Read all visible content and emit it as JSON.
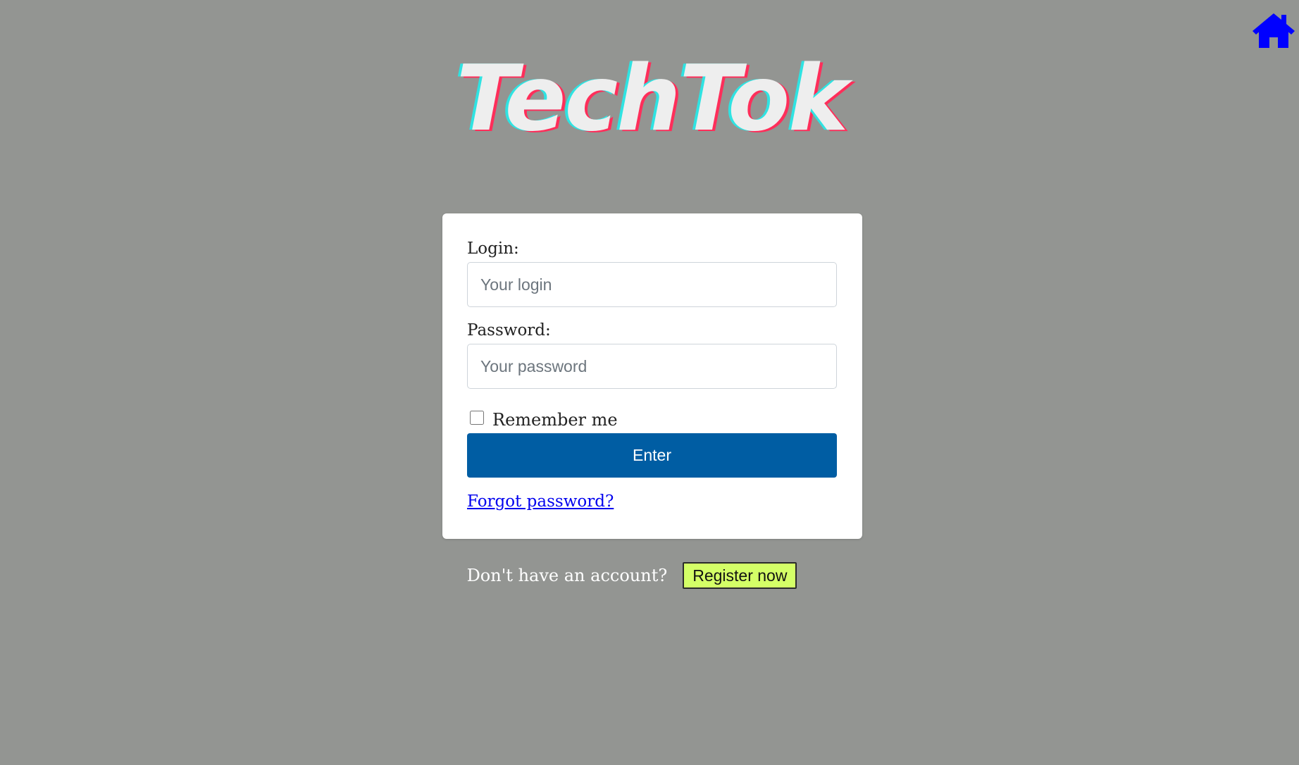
{
  "app": {
    "logo_text": "TechTok",
    "home_icon": "home-icon",
    "home_icon_color": "#0000ff"
  },
  "login_form": {
    "login_label": "Login:",
    "login_placeholder": "Your login",
    "login_value": "",
    "password_label": "Password:",
    "password_placeholder": "Your password",
    "password_value": "",
    "remember_label": "Remember me",
    "remember_checked": false,
    "enter_label": "Enter",
    "forgot_label": "Forgot password?"
  },
  "register": {
    "prompt": "Don't have an account?",
    "button_label": "Register now"
  },
  "colors": {
    "background": "#939592",
    "primary_button": "#005da3",
    "register_button": "#d4ff67",
    "logo_cyan": "#2fe3e2",
    "logo_red": "#ff2e5a"
  }
}
